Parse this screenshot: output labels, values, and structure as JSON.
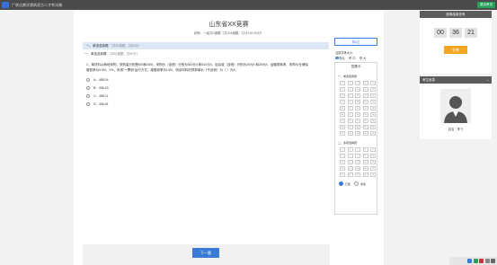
{
  "window": {
    "title": "广联达教学建筑双方人才考试端",
    "exit_label": "退出考试"
  },
  "exam": {
    "title": "山东省XX竞赛",
    "info": "说明：一级共0道题（共100道题，共计100.00分）"
  },
  "section": {
    "title": "一、单选选择题",
    "subtitle": "（共60道题，共60分）"
  },
  "sub_section": {
    "title": "一、单选选择题",
    "subtitle": "（共60道题，共60分）"
  },
  "question": {
    "text": "1、某材料从两地采购，采购量分别是600和400t，采购价（含税）分别为500元/t 和510元/t，运杂费（含税）分别为20元/t 和25元/t，运输损耗率、采购与仓储保管费率为0.5%、2%，采用“一票制”运行方式，增值税率为13%，则该材料的预算单价（不含税）为（ ）元/t。",
    "options": [
      {
        "key": "A",
        "value": "488.04"
      },
      {
        "key": "B",
        "value": "496.43"
      },
      {
        "key": "C",
        "value": "488.11"
      },
      {
        "key": "D",
        "value": "496.51"
      }
    ]
  },
  "navigation": {
    "next_label": "下一题"
  },
  "right_panel": {
    "mark_label": "标记",
    "font_size_label": "当前字体大小：",
    "font_options": [
      "默认",
      "中",
      "大"
    ],
    "card_title": "答题卡",
    "section1_label": "一、单选选择题",
    "section2_label": "二、多项选择题",
    "legend_done": "已答",
    "legend_todo": "未答"
  },
  "answer_card": {
    "section1_cells": [
      "1",
      "2",
      "3",
      "4",
      "5",
      "6",
      "7",
      "8",
      "9",
      "10",
      "11",
      "12",
      "13",
      "14",
      "15",
      "16",
      "17",
      "18",
      "19",
      "20",
      "21",
      "22",
      "23",
      "24",
      "25",
      "26",
      "27",
      "28",
      "29",
      "30",
      "31",
      "32",
      "33",
      "34",
      "35",
      "36",
      "37",
      "38",
      "39",
      "40",
      "41",
      "42",
      "43",
      "44",
      "45"
    ],
    "section2_cells": [
      "1",
      "2",
      "3",
      "4",
      "5",
      "6",
      "7",
      "8",
      "9",
      "10",
      "11",
      "12",
      "13",
      "14",
      "15",
      "16",
      "17",
      "18",
      "19",
      "20",
      "21",
      "22",
      "23",
      "24",
      "25"
    ]
  },
  "timer": {
    "label": "距离结束还有",
    "hours": "00",
    "minutes": "36",
    "seconds": "21",
    "submit_label": "交卷"
  },
  "examinee": {
    "label": "考生信息",
    "name_line": "姓名：李飞"
  },
  "colors": {
    "accent": "#3a7bd5",
    "submit": "#f5a623",
    "exit": "#27a05a",
    "header_dark": "#5c5c5c"
  }
}
